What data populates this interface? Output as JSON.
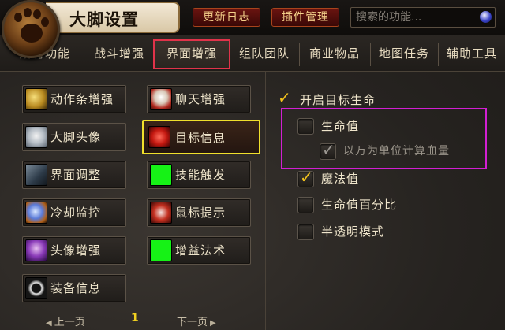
{
  "header": {
    "title": "大脚设置",
    "update_log_label": "更新日志",
    "plugin_manage_label": "插件管理",
    "search_placeholder": "搜索的功能..."
  },
  "tabs": [
    {
      "label": "所有功能"
    },
    {
      "label": "战斗增强"
    },
    {
      "label": "界面增强",
      "active": true
    },
    {
      "label": "组队团队"
    },
    {
      "label": "商业物品"
    },
    {
      "label": "地图任务"
    },
    {
      "label": "辅助工具"
    }
  ],
  "modules": [
    {
      "label": "动作条增强",
      "icon": "gold-gears-icon"
    },
    {
      "label": "聊天增强",
      "icon": "rooster-icon"
    },
    {
      "label": "大脚头像",
      "icon": "seal-pup-icon"
    },
    {
      "label": "目标信息",
      "icon": "red-creature-icon",
      "selected": true
    },
    {
      "label": "界面调整",
      "icon": "rune-tablet-icon"
    },
    {
      "label": "技能触发",
      "icon": "green-square-icon"
    },
    {
      "label": "冷却监控",
      "icon": "crystal-orb-icon"
    },
    {
      "label": "鼠标提示",
      "icon": "red-claw-icon"
    },
    {
      "label": "头像增强",
      "icon": "purple-portrait-icon"
    },
    {
      "label": "增益法术",
      "icon": "green-square-icon"
    },
    {
      "label": "装备信息",
      "icon": "spiked-ring-icon"
    }
  ],
  "pager": {
    "prev_label": "上一页",
    "next_label": "下一页",
    "current_page": "1"
  },
  "options": [
    {
      "label": "开启目标生命",
      "checked": true
    },
    {
      "label": "生命值",
      "checked": false
    },
    {
      "label": "以万为单位计算血量",
      "checked": true,
      "disabled": true
    },
    {
      "label": "魔法值",
      "checked": true
    },
    {
      "label": "生命值百分比",
      "checked": false
    },
    {
      "label": "半透明模式",
      "checked": false
    }
  ],
  "colors": {
    "accent_gold": "#f2c21c",
    "active_tab_outline": "#e0334a",
    "selected_module_outline": "#f0e02c",
    "highlight_outline": "#d21fd2",
    "header_button_bg": "#6a1410"
  }
}
